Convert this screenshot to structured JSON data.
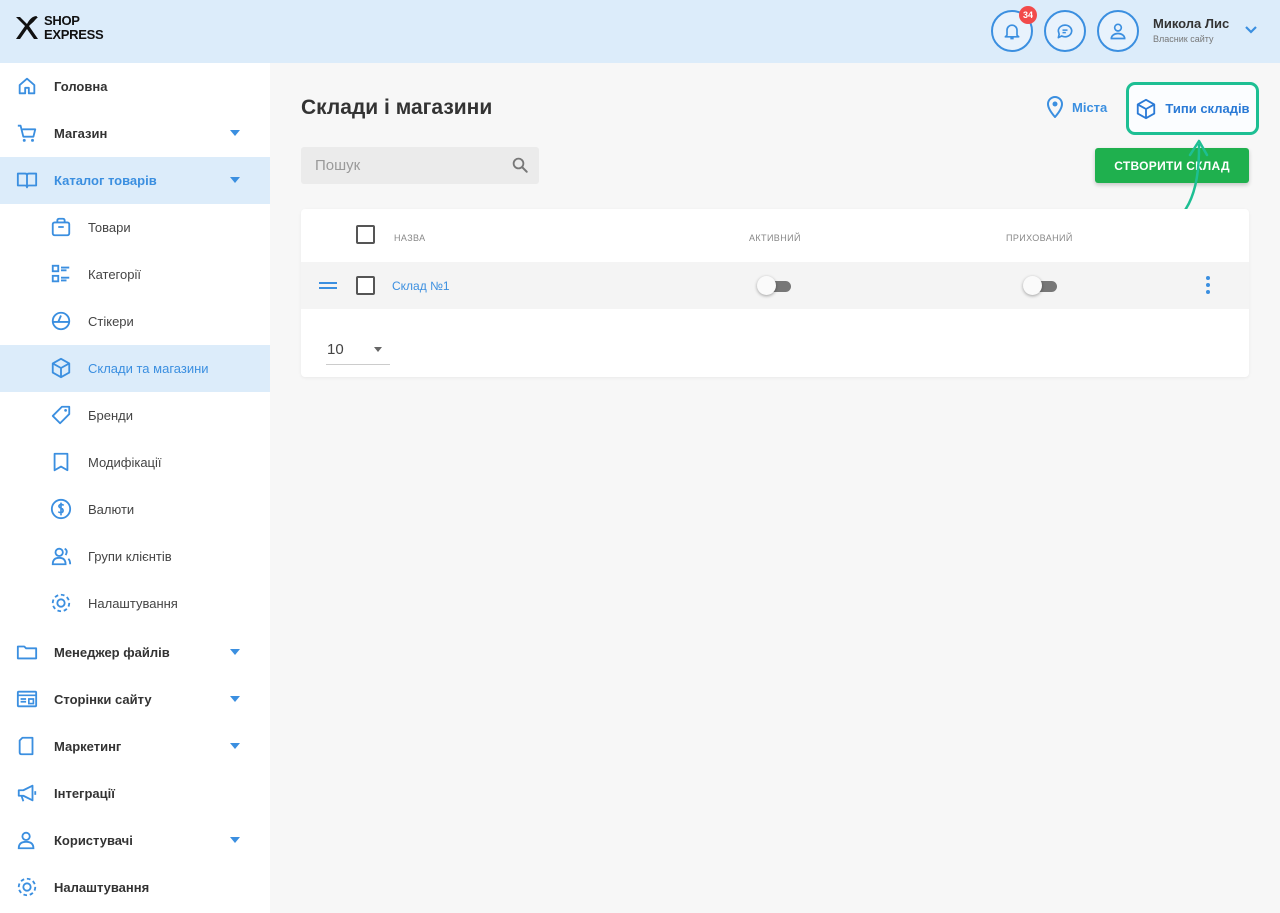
{
  "header": {
    "logo_line1": "SHOP",
    "logo_line2": "EXPRESS",
    "notifications_count": "34",
    "user_name": "Микола Лис",
    "user_subtitle": "Власник сайту"
  },
  "sidebar": {
    "items": [
      {
        "label": "Головна",
        "icon": "home-icon"
      },
      {
        "label": "Магазин",
        "icon": "cart-icon"
      },
      {
        "label": "Каталог товарів",
        "icon": "book-icon"
      },
      {
        "label": "Товари",
        "icon": "product-icon"
      },
      {
        "label": "Категорії",
        "icon": "categories-icon"
      },
      {
        "label": "Стікери",
        "icon": "sticker-icon"
      },
      {
        "label": "Склади та магазини",
        "icon": "box-icon"
      },
      {
        "label": "Бренди",
        "icon": "tag-icon"
      },
      {
        "label": "Модифікації",
        "icon": "bookmark-icon"
      },
      {
        "label": "Валюти",
        "icon": "dollar-icon"
      },
      {
        "label": "Групи клієнтів",
        "icon": "users-icon"
      },
      {
        "label": "Налаштування",
        "icon": "gear-icon"
      },
      {
        "label": "Менеджер файлів",
        "icon": "folder-icon"
      },
      {
        "label": "Сторінки сайту",
        "icon": "pages-icon"
      },
      {
        "label": "Маркетинг",
        "icon": "marketing-icon"
      },
      {
        "label": "Інтеграції",
        "icon": "megaphone-icon"
      },
      {
        "label": "Користувачі",
        "icon": "user-icon"
      },
      {
        "label": "Налаштування",
        "icon": "gear-icon"
      }
    ]
  },
  "main": {
    "title": "Склади і магазини",
    "cities_link": "Міста",
    "warehouse_types_link": "Типи складів",
    "search_placeholder": "Пошук",
    "create_button": "СТВОРИТИ СКЛАД",
    "table": {
      "columns": [
        "Назва",
        "Активний",
        "Прихований"
      ],
      "rows": [
        {
          "name": "Склад №1",
          "active": false,
          "hidden": false
        }
      ]
    },
    "page_size": "10"
  },
  "colors": {
    "accent": "#3b8fe0",
    "header_bg": "#dcecfa",
    "create_button": "#1fb04e",
    "highlight_border": "#1dbf93",
    "badge": "#f24a4a"
  }
}
